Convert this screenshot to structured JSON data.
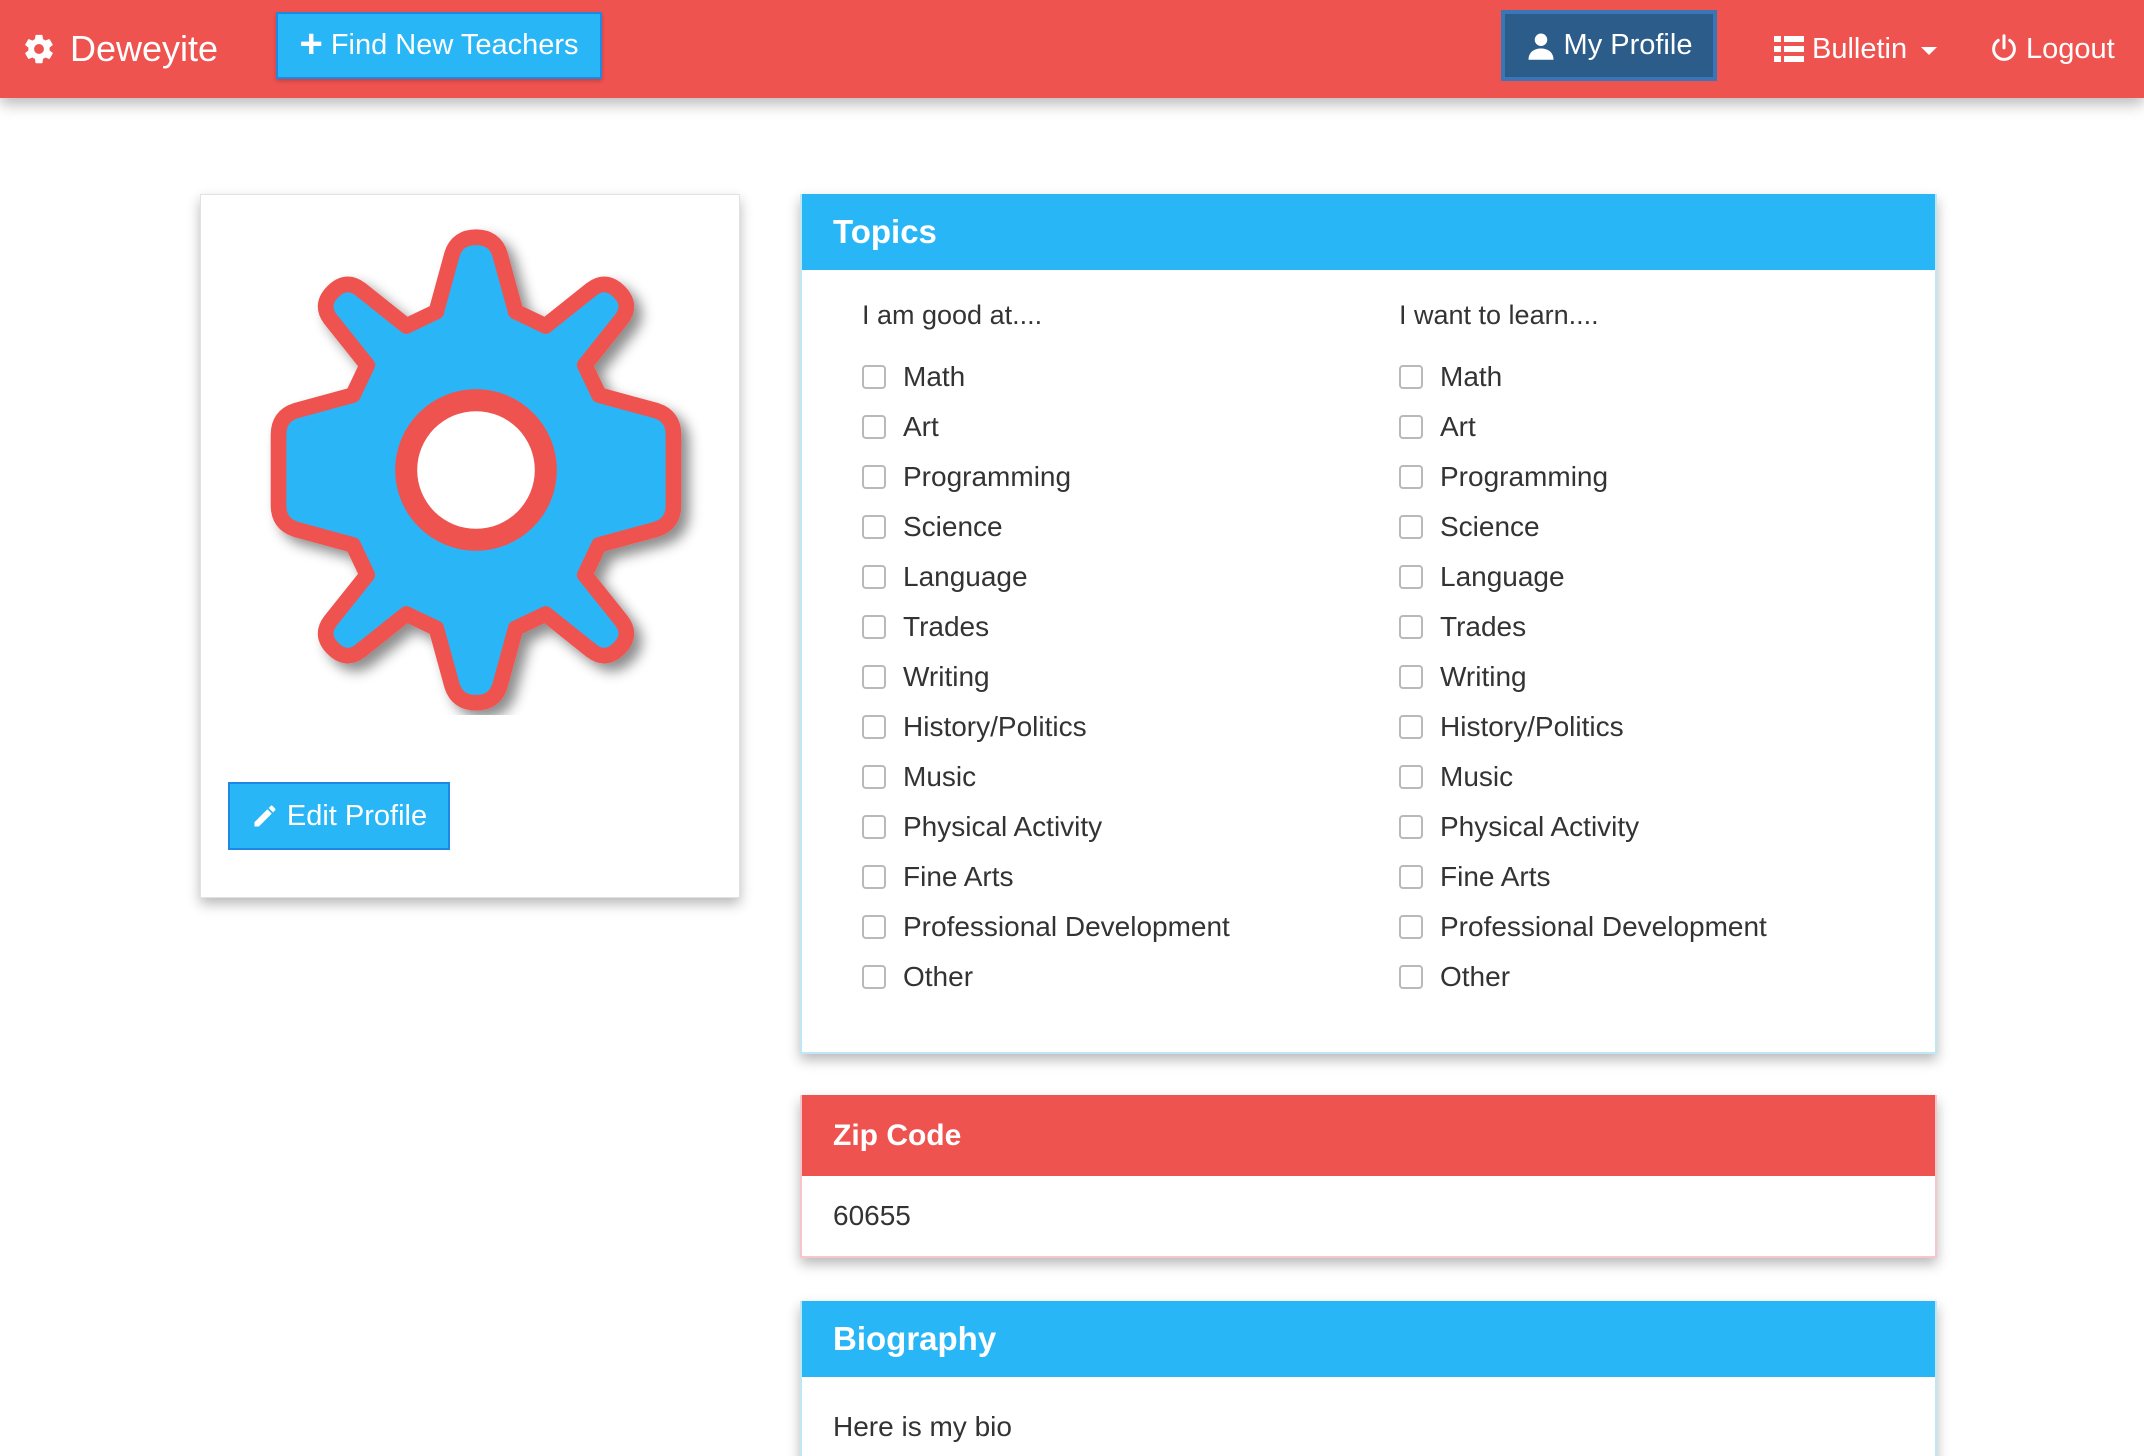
{
  "navbar": {
    "brand": "Deweyite",
    "brand_icon": "gear-icon",
    "find_teachers": "Find New Teachers",
    "my_profile": "My Profile",
    "bulletin": "Bulletin",
    "logout": "Logout",
    "colors": {
      "bar": "#ef5350",
      "accent": "#29b6f6",
      "active": "#2b5c8a"
    }
  },
  "profile": {
    "avatar": "gear-icon",
    "edit_button": "Edit Profile"
  },
  "topics": {
    "title": "Topics",
    "good_at_heading": "I am good at....",
    "want_to_learn_heading": "I want to learn....",
    "good_at": [
      {
        "label": "Math",
        "checked": false
      },
      {
        "label": "Art",
        "checked": false
      },
      {
        "label": "Programming",
        "checked": false
      },
      {
        "label": "Science",
        "checked": false
      },
      {
        "label": "Language",
        "checked": false
      },
      {
        "label": "Trades",
        "checked": false
      },
      {
        "label": "Writing",
        "checked": false
      },
      {
        "label": "History/Politics",
        "checked": false
      },
      {
        "label": "Music",
        "checked": false
      },
      {
        "label": "Physical Activity",
        "checked": false
      },
      {
        "label": "Fine Arts",
        "checked": false
      },
      {
        "label": "Professional Development",
        "checked": false
      },
      {
        "label": "Other",
        "checked": false
      }
    ],
    "want_to_learn": [
      {
        "label": "Math",
        "checked": false
      },
      {
        "label": "Art",
        "checked": false
      },
      {
        "label": "Programming",
        "checked": false
      },
      {
        "label": "Science",
        "checked": false
      },
      {
        "label": "Language",
        "checked": false
      },
      {
        "label": "Trades",
        "checked": false
      },
      {
        "label": "Writing",
        "checked": false
      },
      {
        "label": "History/Politics",
        "checked": false
      },
      {
        "label": "Music",
        "checked": false
      },
      {
        "label": "Physical Activity",
        "checked": false
      },
      {
        "label": "Fine Arts",
        "checked": false
      },
      {
        "label": "Professional Development",
        "checked": false
      },
      {
        "label": "Other",
        "checked": false
      }
    ]
  },
  "zip": {
    "title": "Zip Code",
    "value": "60655"
  },
  "bio": {
    "title": "Biography",
    "value": "Here is my bio"
  }
}
